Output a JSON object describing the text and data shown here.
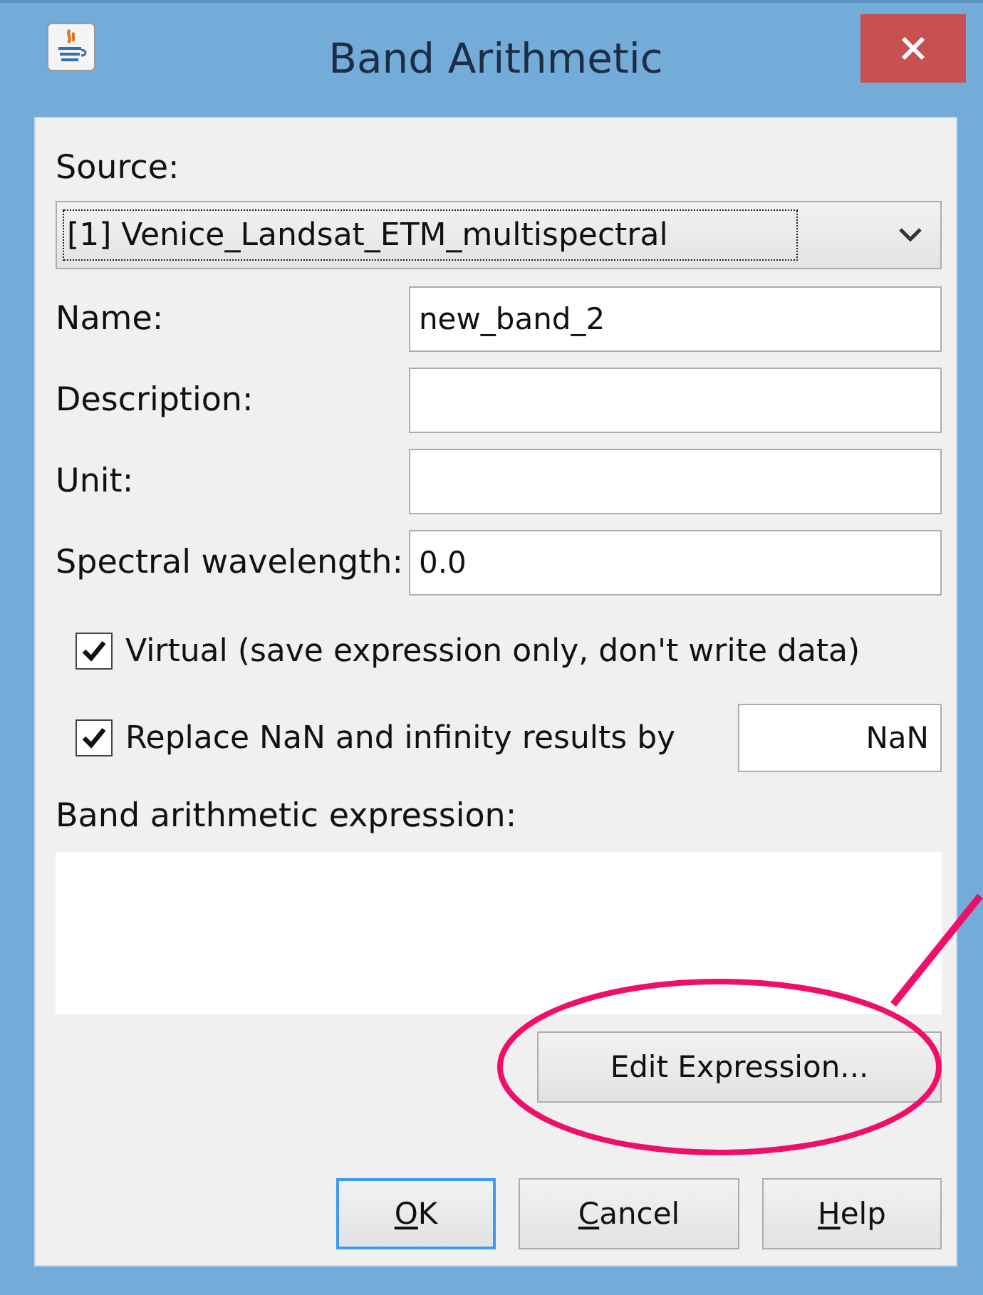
{
  "window": {
    "title": "Band Arithmetic"
  },
  "source": {
    "label": "Source:",
    "value": "[1] Venice_Landsat_ETM_multispectral"
  },
  "fields": [
    {
      "label": "Name:",
      "value": "new_band_2"
    },
    {
      "label": "Description:"
    },
    {
      "label": "Unit:"
    },
    {
      "label": "Spectral wavelength:",
      "value": "0.0"
    }
  ],
  "options": [
    {
      "label": "Virtual (save expression only, don't write data)",
      "checked": true
    },
    {
      "label": "Replace NaN and infinity results by",
      "checked": true,
      "value": "NaN"
    }
  ],
  "expression": {
    "label": "Band arithmetic expression:"
  },
  "edit_button": "Edit Expression...",
  "buttons": [
    {
      "mnemonic": "O",
      "rest": "K",
      "selected": true
    },
    {
      "mnemonic": "C",
      "rest": "ancel",
      "selected": false
    },
    {
      "mnemonic": "H",
      "rest": "elp",
      "selected": false
    }
  ]
}
